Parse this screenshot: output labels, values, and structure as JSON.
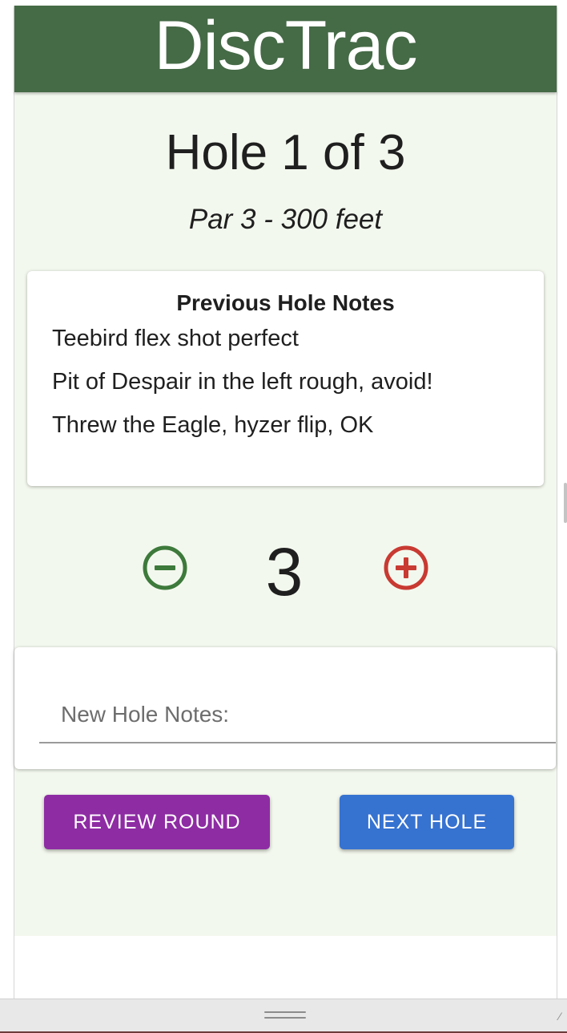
{
  "app": {
    "title": "DiscTrac",
    "brand_color": "#456a46",
    "background_color": "#f3f8ee"
  },
  "hole": {
    "title": "Hole 1 of 3",
    "details": "Par 3 - 300 feet"
  },
  "previous_notes": {
    "heading": "Previous Hole Notes",
    "items": [
      "Teebird flex shot perfect",
      "Pit of Despair in the left rough, avoid!",
      "Threw the Eagle, hyzer flip, OK"
    ]
  },
  "score": {
    "value": "3",
    "decrement_icon": "minus-circle-icon",
    "increment_icon": "plus-circle-icon",
    "decrement_color": "#3d7a3b",
    "increment_color": "#c83a32"
  },
  "new_notes": {
    "placeholder": "New Hole Notes:",
    "value": ""
  },
  "actions": {
    "review_label": "REVIEW ROUND",
    "next_label": "NEXT HOLE",
    "review_color": "#8e2ca4",
    "next_color": "#3672d0"
  }
}
